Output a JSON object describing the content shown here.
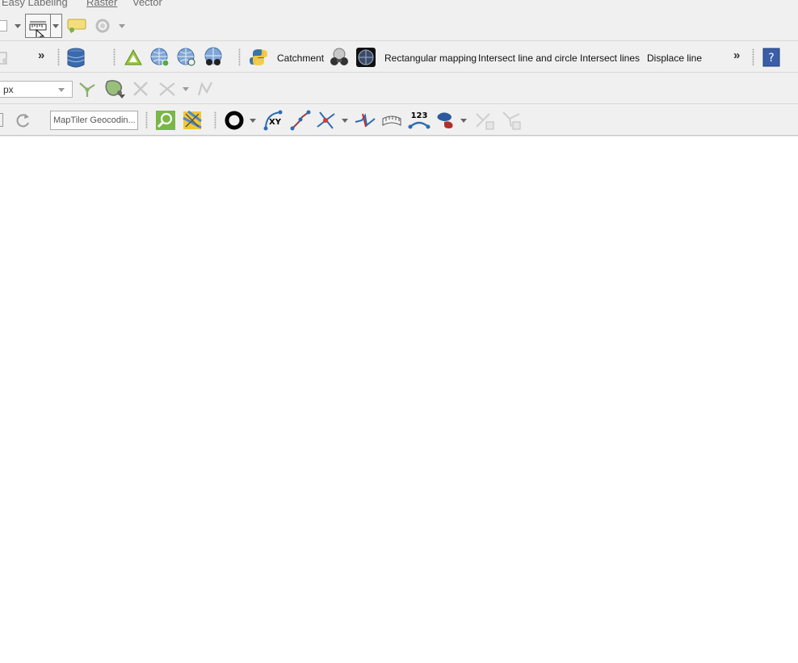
{
  "menubar": {
    "items": [
      "Easy Labeling",
      "Raster",
      "Vector"
    ]
  },
  "toolbar2": {
    "more_label": "»",
    "buttons": [
      "Catchment",
      "Rectangular mapping",
      "Intersect line and circle",
      "Intersect lines",
      "Displace line"
    ],
    "overflow_label": "»"
  },
  "toolbar3": {
    "unit_value": "px"
  },
  "toolbar4": {
    "geocoding_placeholder": "MapTiler Geocodin...",
    "xy_label": "XY",
    "numbers_label": "123"
  },
  "icons": [
    "layer-icon",
    "measure-icon",
    "map-tips-icon",
    "identify-features-icon",
    "add-layer-icon",
    "database-icon",
    "triangle-icon",
    "globe-add-icon",
    "globe-search-icon",
    "globe-binoculars-icon",
    "python-icon",
    "binoculars-icon",
    "dark-globe-icon",
    "help-icon",
    "snap-icon",
    "vertex-tool-icon",
    "delete-icon",
    "split-icon",
    "reshape-icon",
    "refresh-icon",
    "zoom-search-icon",
    "crosshair-map-icon",
    "circle-icon",
    "xy-curve-icon",
    "line-icon",
    "intersect-icon",
    "break-line-icon",
    "ruler-icon",
    "number-line-icon",
    "blob-icon",
    "copy-vertex-icon",
    "node-branch-icon"
  ],
  "colors": {
    "toolbar_bg": "#f0f0f0",
    "canvas_bg": "#ffffff",
    "accent_blue": "#2c6cb0",
    "help_bg": "#3a5ea8"
  }
}
